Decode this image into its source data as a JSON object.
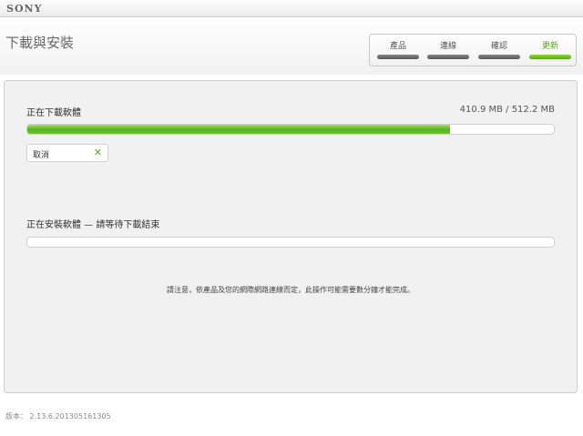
{
  "brand": "SONY",
  "page_title": "下載與安裝",
  "steps": [
    {
      "label": "產品",
      "active": false
    },
    {
      "label": "連線",
      "active": false
    },
    {
      "label": "確認",
      "active": false
    },
    {
      "label": "更新",
      "active": true
    }
  ],
  "download": {
    "label": "正在下載軟體",
    "size_text": "410.9 MB / 512.2 MB",
    "progress": 0.8022
  },
  "cancel_label": "取消",
  "cancel_icon": "close-icon",
  "install": {
    "label": "正在安裝軟體 — 請等待下載結束",
    "progress": 0
  },
  "note": "請注意，依產品及您的網際網路連線而定，此操作可能需要數分鐘才能完成。",
  "version": "版本： 2.13.6.201305161305",
  "colors": {
    "accent": "#5aa81e",
    "progress": "#57b120"
  }
}
